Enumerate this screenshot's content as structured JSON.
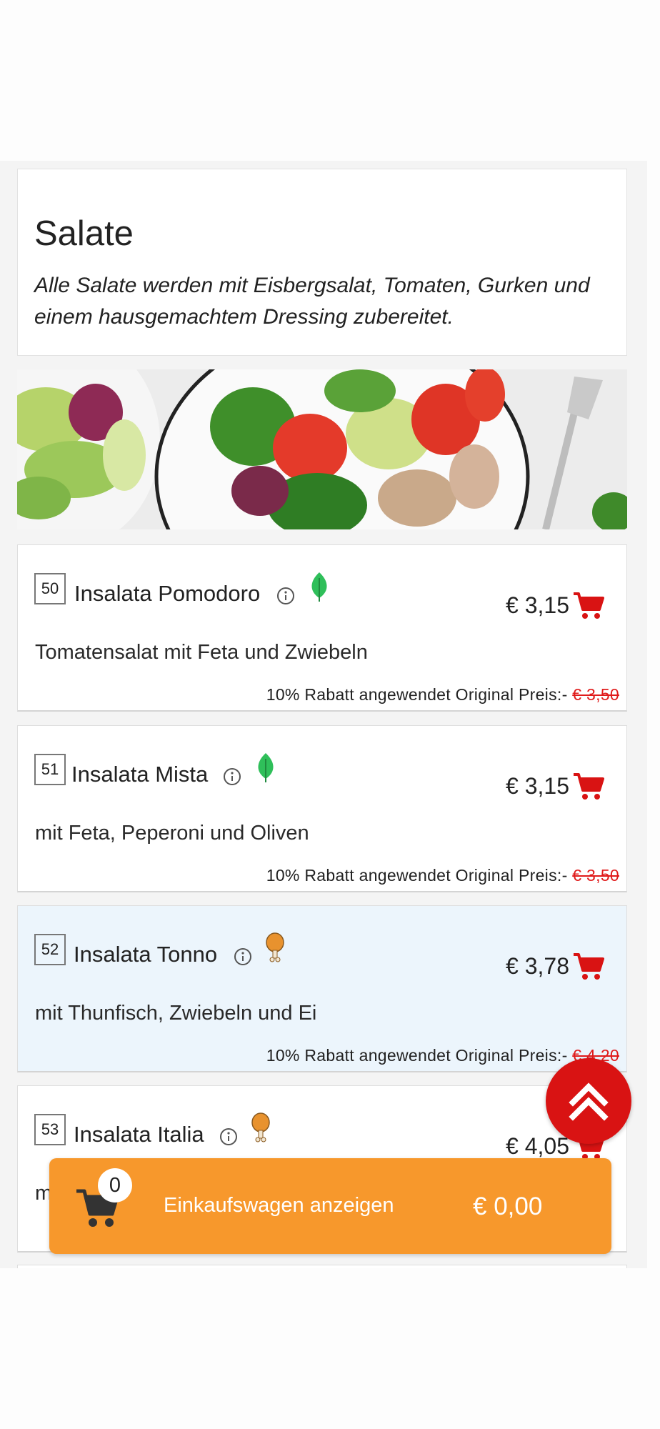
{
  "category": {
    "title": "Salate",
    "description": "Alle Salate werden mit Eisbergsalat, Tomaten, Gurken und einem hausgemachtem Dressing zubereitet."
  },
  "items": [
    {
      "number": "50",
      "name": "Insalata Pomodoro",
      "badge_icon": "leaf-icon",
      "price": "€ 3,15",
      "description": "Tomatensalat mit Feta und Zwiebeln",
      "discount_text": "10% Rabatt angewendet Original Preis:-",
      "original_price": "€ 3,50"
    },
    {
      "number": "51",
      "name": "Insalata Mista",
      "badge_icon": "leaf-icon",
      "price": "€ 3,15",
      "description": "mit Feta, Peperoni und Oliven",
      "discount_text": "10% Rabatt angewendet Original Preis:-",
      "original_price": "€ 3,50"
    },
    {
      "number": "52",
      "name": "Insalata Tonno",
      "badge_icon": "chicken-leg-icon",
      "price": "€ 3,78",
      "description": "mit Thunfisch, Zwiebeln und Ei",
      "discount_text": "10% Rabatt angewendet Original Preis:-",
      "original_price": "€ 4,20"
    },
    {
      "number": "53",
      "name": "Insalata Italia",
      "badge_icon": "chicken-leg-icon",
      "price": "€ 4,05",
      "description": "m",
      "discount_text": "",
      "original_price": ""
    }
  ],
  "cart": {
    "count": "0",
    "label": "Einkaufswagen anzeigen",
    "total": "€ 0,00"
  },
  "colors": {
    "accent_red": "#d91313",
    "cart_orange": "#f7982c",
    "veg_green": "#2fbf5a",
    "meat_orange": "#e8922e",
    "highlight_blue": "#ecf5fc"
  },
  "icons": {
    "cart": "cart-icon",
    "info": "info-icon",
    "scroll_top": "double-chevron-up-icon"
  }
}
